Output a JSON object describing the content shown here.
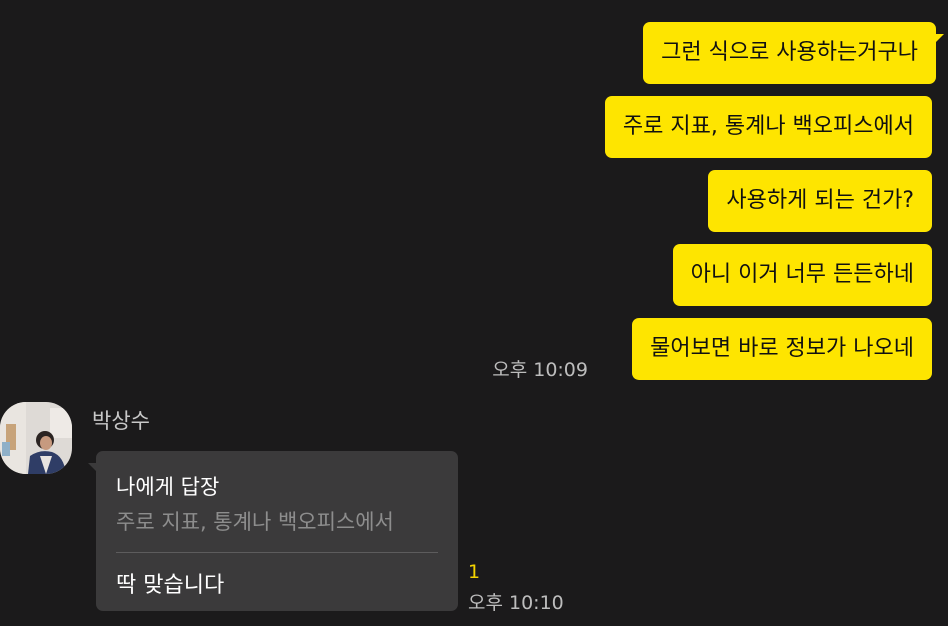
{
  "outgoing_messages": [
    {
      "text": "그런 식으로 사용하는거구나"
    },
    {
      "text": "주로 지표, 통계나 백오피스에서"
    },
    {
      "text": "사용하게 되는 건가?"
    },
    {
      "text": "아니 이거 너무 든든하네"
    },
    {
      "text": "물어보면 바로 정보가 나오네"
    }
  ],
  "outgoing_time": "오후 10:09",
  "incoming": {
    "sender": "박상수",
    "reply_header": "나에게 답장",
    "reply_quote": "주로 지표, 통계나 백오피스에서",
    "text": "딱 맞습니다",
    "unread_count": "1",
    "time": "오후 10:10"
  }
}
